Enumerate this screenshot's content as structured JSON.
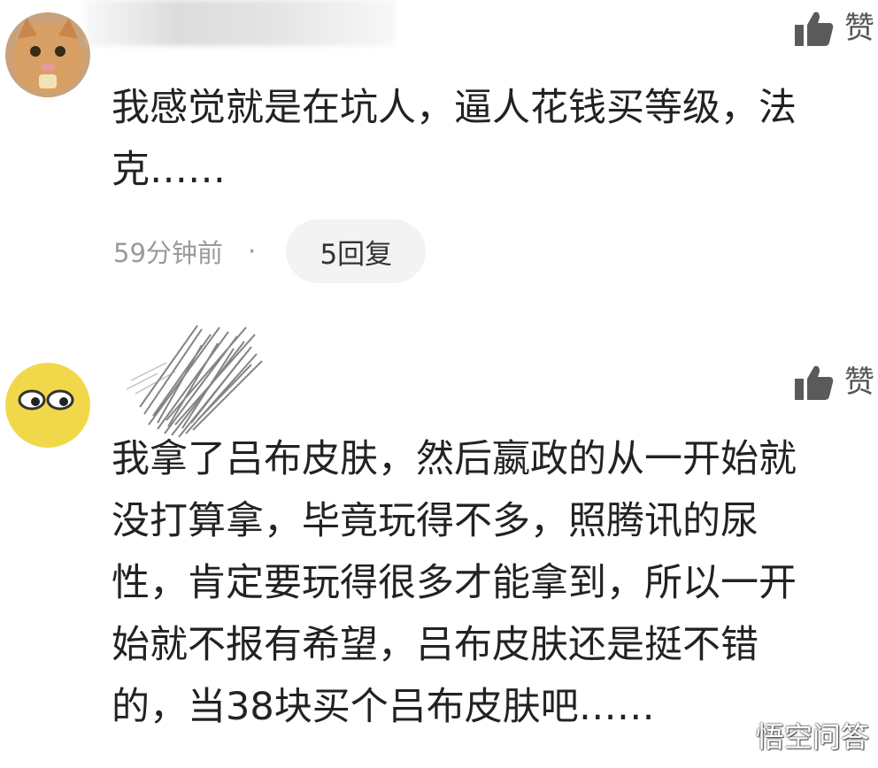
{
  "comments": [
    {
      "like_label": "赞",
      "lines": [
        "我感觉就是在坑人，逼人花钱买等级，法",
        "克……"
      ],
      "time": "59分钟前",
      "separator": "·",
      "reply_label": "5回复"
    },
    {
      "like_label": "赞",
      "lines": [
        "我拿了吕布皮肤，然后嬴政的从一开始就",
        "没打算拿，毕竟玩得不多，照腾讯的尿",
        "性，肯定要玩得很多才能拿到，所以一开",
        "始就不报有希望，吕布皮肤还是挺不错",
        "的，当38块买个吕布皮肤吧……"
      ]
    }
  ],
  "watermark": {
    "text": "悟空问答",
    "icon": "watermark-logo-icon"
  },
  "colors": {
    "text": "#222222",
    "meta": "#9a9a9a",
    "reply_bg": "#f3f3f3",
    "like_icon": "#5a5a5a"
  }
}
